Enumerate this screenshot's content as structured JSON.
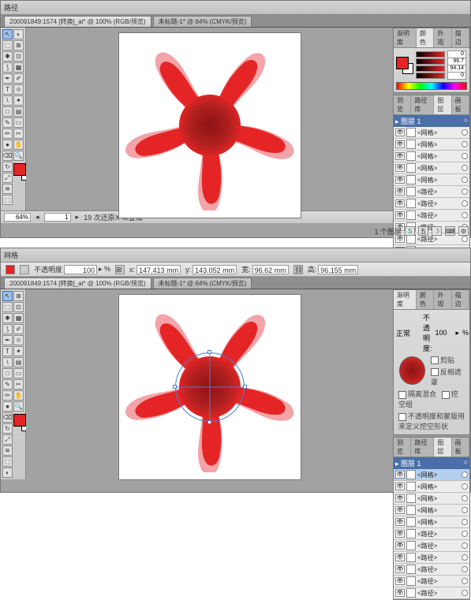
{
  "app1": {
    "topbar": {
      "label": "路径"
    },
    "tabs": [
      {
        "label": "200091849:1574 [转换]_ai* @ 100% (RGB/预览)"
      },
      {
        "label": "未标题-1* @ 64% (CMYK/预览)"
      }
    ],
    "status": {
      "zoom": "64%",
      "page": "1",
      "desc": "19 次还原X 未要做"
    },
    "right_status": {
      "count": "1 个图层"
    },
    "color_panel": {
      "tabs": [
        "渐明度",
        "颜色",
        "外观",
        "描边"
      ],
      "sliders": [
        {
          "val": "0"
        },
        {
          "val": "96.7"
        },
        {
          "val": "94.14"
        },
        {
          "val": "0"
        }
      ]
    },
    "layers_panel": {
      "tabs": [
        "测览",
        "路径库",
        "图层",
        "画板"
      ],
      "header": "图层 1",
      "rows": [
        {
          "name": "<网格>"
        },
        {
          "name": "<网格>"
        },
        {
          "name": "<网格>"
        },
        {
          "name": "<网格>"
        },
        {
          "name": "<网格>"
        },
        {
          "name": "<路径>"
        },
        {
          "name": "<路径>"
        },
        {
          "name": "<路径>"
        },
        {
          "name": "<路径>"
        },
        {
          "name": "<路径>"
        },
        {
          "name": "<路径>"
        }
      ]
    }
  },
  "app2": {
    "topbar": {
      "label": "网格"
    },
    "optbar": {
      "opacity_label": "不透明度",
      "opacity_val": "100",
      "x_label": "x:",
      "x_val": "147.413 mm",
      "y_label": "y:",
      "y_val": "143.052 mm",
      "w_label": "宽:",
      "w_val": "96.62 mm",
      "h_label": "高:",
      "h_val": "96.155 mm"
    },
    "tabs": [
      {
        "label": "200091849:1574 [转换]_ai* @ 100% (RGB/预览)"
      },
      {
        "label": "未标题-1* @ 64% (CMYK/预览)"
      }
    ],
    "appear_panel": {
      "tabs": [
        "渐明度",
        "颜色",
        "外观",
        "描边"
      ],
      "mode": "正常",
      "opacity_label": "不透明度:",
      "opacity_val": "100",
      "pct": "%",
      "line1": "剪贴",
      "line2": "反相遮罩",
      "chk1": "隔离混合",
      "chk2": "挖空组",
      "chk3": "不透明度和蒙版用来定义挖空形状"
    },
    "layers_panel": {
      "tabs": [
        "测览",
        "路径库",
        "图层",
        "画板"
      ],
      "header": "图层 1",
      "rows": [
        {
          "name": "<网格>"
        },
        {
          "name": "<网格>"
        },
        {
          "name": "<网格>"
        },
        {
          "name": "<网格>"
        },
        {
          "name": "<网格>"
        },
        {
          "name": "<路径>"
        },
        {
          "name": "<路径>"
        },
        {
          "name": "<路径>"
        },
        {
          "name": "<路径>"
        },
        {
          "name": "<路径>"
        },
        {
          "name": "<路径>"
        }
      ]
    }
  },
  "tools": [
    "↖",
    "⬚",
    "✒",
    "T",
    "/",
    "□",
    "✎",
    "✂",
    "↻",
    "◐",
    "⊞",
    "✦",
    "➚",
    "⬛",
    "▭",
    "◧",
    "▤",
    "⬚",
    "✋",
    "🔍"
  ]
}
